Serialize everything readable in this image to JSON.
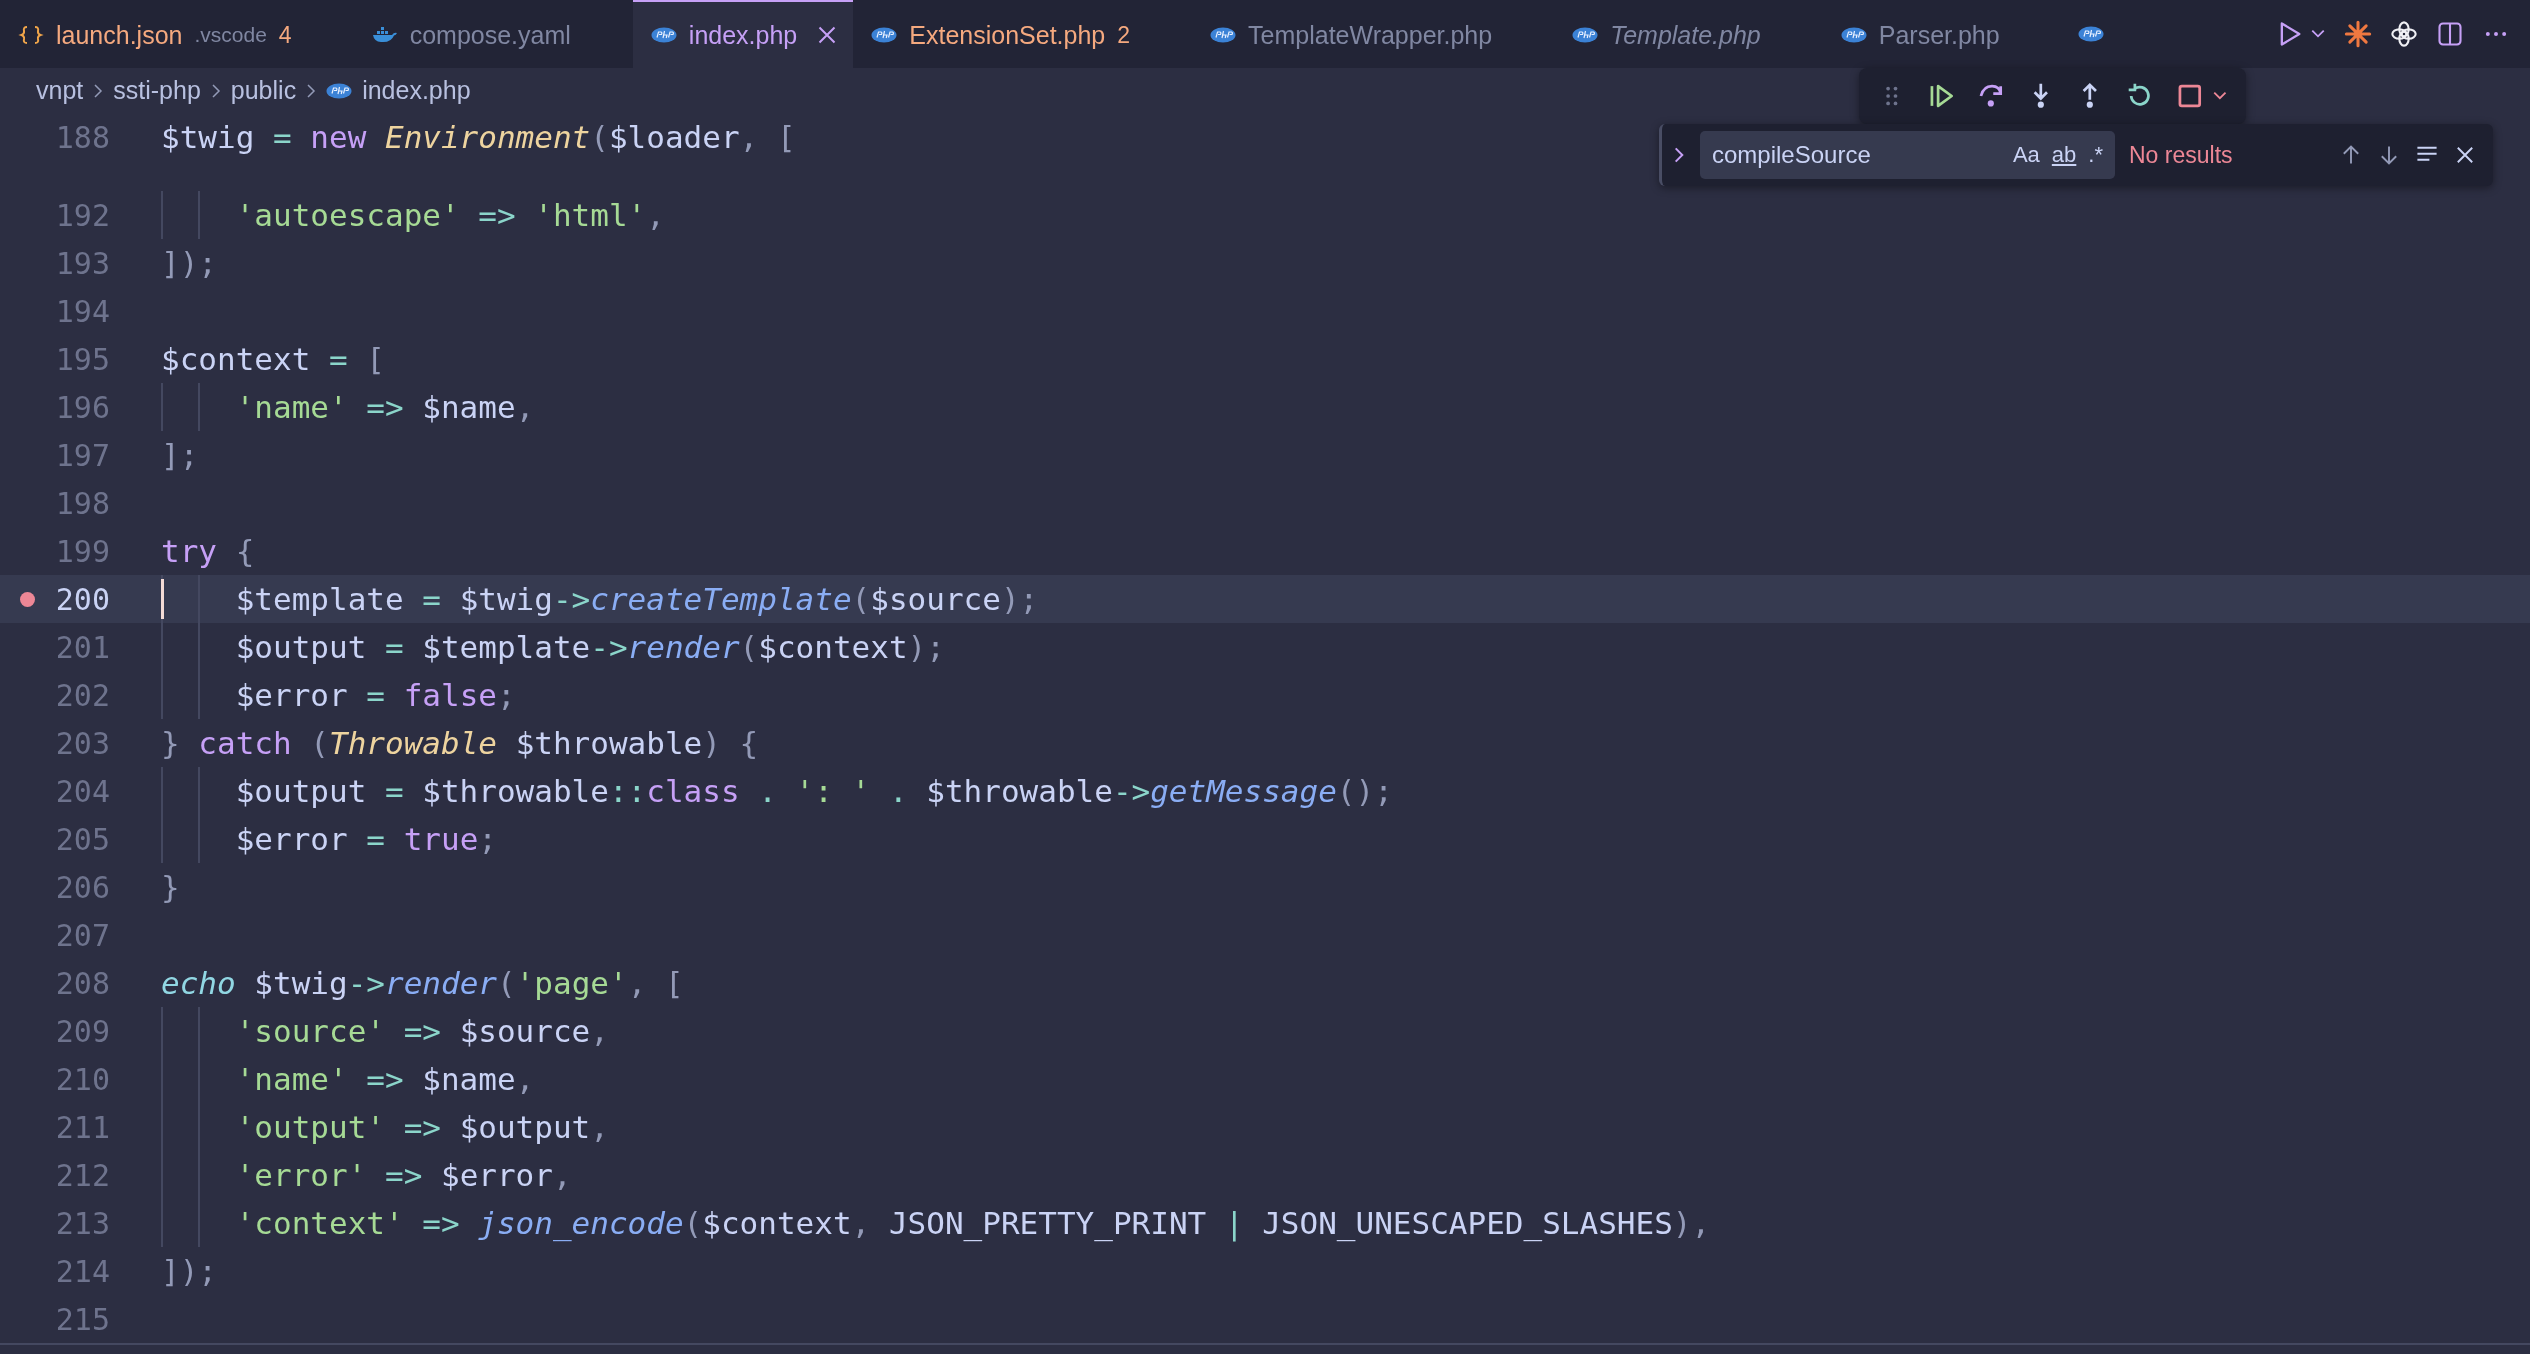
{
  "tabs": [
    {
      "kind": "json",
      "label": "launch.json",
      "description": ".vscode",
      "badge": "4",
      "warning": true,
      "selected": false,
      "preview": false
    },
    {
      "kind": "docker",
      "label": "compose.yaml",
      "warning": false,
      "selected": false,
      "preview": false
    },
    {
      "kind": "php",
      "label": "index.php",
      "warning": false,
      "selected": true,
      "preview": false
    },
    {
      "kind": "php",
      "label": "ExtensionSet.php",
      "badge": "2",
      "warning": true,
      "selected": false,
      "preview": false
    },
    {
      "kind": "php",
      "label": "TemplateWrapper.php",
      "warning": false,
      "selected": false,
      "preview": false
    },
    {
      "kind": "php",
      "label": "Template.php",
      "warning": false,
      "selected": false,
      "preview": true
    },
    {
      "kind": "php",
      "label": "Parser.php",
      "warning": false,
      "selected": false,
      "preview": false
    }
  ],
  "clipped_tab": {
    "kind": "php"
  },
  "breadcrumbs": [
    {
      "label": "vnpt"
    },
    {
      "label": "ssti-php"
    },
    {
      "label": "public"
    },
    {
      "label": "index.php",
      "kind": "php"
    }
  ],
  "find": {
    "value": "compileSource",
    "options": [
      {
        "label": "Aa",
        "on": false
      },
      {
        "label": "ab",
        "on": false
      },
      {
        "label": ".*",
        "on": false
      }
    ],
    "status": "No results"
  },
  "sticky_line": {
    "number": "188",
    "code": [
      {
        "kind": "v",
        "text": "$twig "
      },
      {
        "kind": "o",
        "text": "= "
      },
      {
        "kind": "k",
        "text": "new "
      },
      {
        "kind": "t",
        "text": "Environment"
      },
      {
        "kind": "p",
        "text": "("
      },
      {
        "kind": "v",
        "text": "$loader"
      },
      {
        "kind": "p",
        "text": ", ["
      }
    ]
  },
  "lines": [
    {
      "number": "192",
      "breakpoint": false,
      "current": false,
      "code": [
        {
          "kind": "s",
          "text": "    'autoescape'"
        },
        {
          "kind": "o",
          "text": " => "
        },
        {
          "kind": "s",
          "text": "'html'"
        },
        {
          "kind": "p",
          "text": ","
        }
      ]
    },
    {
      "number": "193",
      "breakpoint": false,
      "current": false,
      "code": [
        {
          "kind": "p",
          "text": "]);"
        }
      ]
    },
    {
      "number": "194",
      "breakpoint": false,
      "current": false
    },
    {
      "number": "195",
      "breakpoint": false,
      "current": false,
      "code": [
        {
          "kind": "v",
          "text": "$context "
        },
        {
          "kind": "o",
          "text": "= "
        },
        {
          "kind": "p",
          "text": "["
        }
      ]
    },
    {
      "number": "196",
      "breakpoint": false,
      "current": false,
      "code": [
        {
          "kind": "s",
          "text": "    'name'"
        },
        {
          "kind": "o",
          "text": " => "
        },
        {
          "kind": "v",
          "text": "$name"
        },
        {
          "kind": "p",
          "text": ","
        }
      ]
    },
    {
      "number": "197",
      "breakpoint": false,
      "current": false,
      "code": [
        {
          "kind": "p",
          "text": "];"
        }
      ]
    },
    {
      "number": "198",
      "breakpoint": false,
      "current": false
    },
    {
      "number": "199",
      "breakpoint": false,
      "current": false,
      "code": [
        {
          "kind": "k",
          "text": "try "
        },
        {
          "kind": "p",
          "text": "{"
        }
      ]
    },
    {
      "number": "200",
      "breakpoint": true,
      "current": true,
      "code": [
        {
          "kind": "v",
          "text": "    $template "
        },
        {
          "kind": "o",
          "text": "= "
        },
        {
          "kind": "v",
          "text": "$twig"
        },
        {
          "kind": "o",
          "text": "->"
        },
        {
          "kind": "f",
          "text": "createTemplate"
        },
        {
          "kind": "p",
          "text": "("
        },
        {
          "kind": "v",
          "text": "$source"
        },
        {
          "kind": "p",
          "text": ");"
        }
      ]
    },
    {
      "number": "201",
      "breakpoint": false,
      "current": false,
      "code": [
        {
          "kind": "v",
          "text": "    $output "
        },
        {
          "kind": "o",
          "text": "= "
        },
        {
          "kind": "v",
          "text": "$template"
        },
        {
          "kind": "o",
          "text": "->"
        },
        {
          "kind": "f",
          "text": "render"
        },
        {
          "kind": "p",
          "text": "("
        },
        {
          "kind": "v",
          "text": "$context"
        },
        {
          "kind": "p",
          "text": ");"
        }
      ]
    },
    {
      "number": "202",
      "breakpoint": false,
      "current": false,
      "code": [
        {
          "kind": "v",
          "text": "    $error "
        },
        {
          "kind": "o",
          "text": "= "
        },
        {
          "kind": "k",
          "text": "false"
        },
        {
          "kind": "p",
          "text": ";"
        }
      ]
    },
    {
      "number": "203",
      "breakpoint": false,
      "current": false,
      "code": [
        {
          "kind": "p",
          "text": "} "
        },
        {
          "kind": "k",
          "text": "catch "
        },
        {
          "kind": "p",
          "text": "("
        },
        {
          "kind": "t",
          "text": "Throwable"
        },
        {
          "kind": "v",
          "text": " $throwable"
        },
        {
          "kind": "p",
          "text": ") {"
        }
      ]
    },
    {
      "number": "204",
      "breakpoint": false,
      "current": false,
      "code": [
        {
          "kind": "v",
          "text": "    $output "
        },
        {
          "kind": "o",
          "text": "= "
        },
        {
          "kind": "v",
          "text": "$throwable"
        },
        {
          "kind": "o",
          "text": "::"
        },
        {
          "kind": "k",
          "text": "class "
        },
        {
          "kind": "o",
          "text": ". "
        },
        {
          "kind": "s",
          "text": "': ' "
        },
        {
          "kind": "o",
          "text": ". "
        },
        {
          "kind": "v",
          "text": "$throwable"
        },
        {
          "kind": "o",
          "text": "->"
        },
        {
          "kind": "f",
          "text": "getMessage"
        },
        {
          "kind": "p",
          "text": "();"
        }
      ]
    },
    {
      "number": "205",
      "breakpoint": false,
      "current": false,
      "code": [
        {
          "kind": "v",
          "text": "    $error "
        },
        {
          "kind": "o",
          "text": "= "
        },
        {
          "kind": "k",
          "text": "true"
        },
        {
          "kind": "p",
          "text": ";"
        }
      ]
    },
    {
      "number": "206",
      "breakpoint": false,
      "current": false,
      "code": [
        {
          "kind": "p",
          "text": "}"
        }
      ]
    },
    {
      "number": "207",
      "breakpoint": false,
      "current": false
    },
    {
      "number": "208",
      "breakpoint": false,
      "current": false,
      "code": [
        {
          "kind": "b",
          "text": "echo "
        },
        {
          "kind": "v",
          "text": "$twig"
        },
        {
          "kind": "o",
          "text": "->"
        },
        {
          "kind": "f",
          "text": "render"
        },
        {
          "kind": "p",
          "text": "("
        },
        {
          "kind": "s",
          "text": "'page'"
        },
        {
          "kind": "p",
          "text": ", ["
        }
      ]
    },
    {
      "number": "209",
      "breakpoint": false,
      "current": false,
      "code": [
        {
          "kind": "s",
          "text": "    'source'"
        },
        {
          "kind": "o",
          "text": " => "
        },
        {
          "kind": "v",
          "text": "$source"
        },
        {
          "kind": "p",
          "text": ","
        }
      ]
    },
    {
      "number": "210",
      "breakpoint": false,
      "current": false,
      "code": [
        {
          "kind": "s",
          "text": "    'name'"
        },
        {
          "kind": "o",
          "text": " => "
        },
        {
          "kind": "v",
          "text": "$name"
        },
        {
          "kind": "p",
          "text": ","
        }
      ]
    },
    {
      "number": "211",
      "breakpoint": false,
      "current": false,
      "code": [
        {
          "kind": "s",
          "text": "    'output'"
        },
        {
          "kind": "o",
          "text": " => "
        },
        {
          "kind": "v",
          "text": "$output"
        },
        {
          "kind": "p",
          "text": ","
        }
      ]
    },
    {
      "number": "212",
      "breakpoint": false,
      "current": false,
      "code": [
        {
          "kind": "s",
          "text": "    'error'"
        },
        {
          "kind": "o",
          "text": " => "
        },
        {
          "kind": "v",
          "text": "$error"
        },
        {
          "kind": "p",
          "text": ","
        }
      ]
    },
    {
      "number": "213",
      "breakpoint": false,
      "current": false,
      "code": [
        {
          "kind": "s",
          "text": "    'context'"
        },
        {
          "kind": "o",
          "text": " => "
        },
        {
          "kind": "f",
          "text": "json_encode"
        },
        {
          "kind": "p",
          "text": "("
        },
        {
          "kind": "v",
          "text": "$context"
        },
        {
          "kind": "p",
          "text": ", "
        },
        {
          "kind": "v",
          "text": "JSON_PRETTY_PRINT "
        },
        {
          "kind": "o",
          "text": "| "
        },
        {
          "kind": "v",
          "text": "JSON_UNESCAPED_SLASHES"
        },
        {
          "kind": "p",
          "text": "),"
        }
      ]
    },
    {
      "number": "214",
      "breakpoint": false,
      "current": false,
      "code": [
        {
          "kind": "p",
          "text": "]);"
        }
      ]
    },
    {
      "number": "215",
      "breakpoint": false,
      "current": false
    }
  ]
}
